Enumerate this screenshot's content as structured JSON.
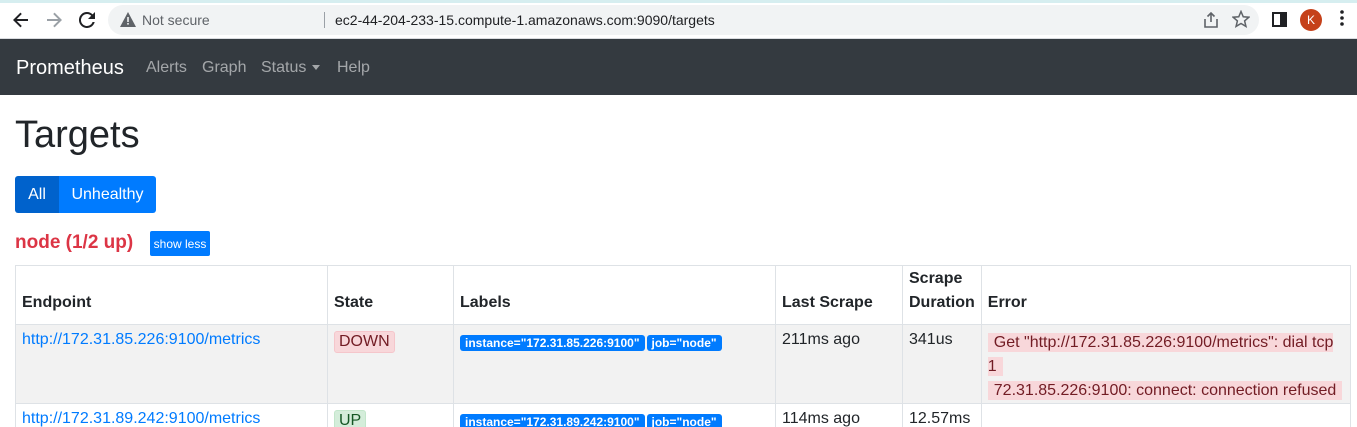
{
  "browser": {
    "security_label": "Not secure",
    "url": "ec2-44-204-233-15.compute-1.amazonaws.com:9090/targets",
    "profile_initial": "K"
  },
  "navbar": {
    "brand": "Prometheus",
    "links": [
      "Alerts",
      "Graph",
      "Status",
      "Help"
    ]
  },
  "page": {
    "title": "Targets",
    "filters": [
      "All",
      "Unhealthy"
    ],
    "job_title": "node (1/2 up)",
    "show_less": "show less"
  },
  "table": {
    "headers": {
      "endpoint": "Endpoint",
      "state": "State",
      "labels": "Labels",
      "last_scrape": "Last Scrape",
      "scrape_duration_1": "Scrape",
      "scrape_duration_2": "Duration",
      "error": "Error"
    },
    "rows": [
      {
        "endpoint": "http://172.31.85.226:9100/metrics",
        "state": "DOWN",
        "label_instance": "instance=\"172.31.85.226:9100\"",
        "label_job": "job=\"node\"",
        "last_scrape": "211ms ago",
        "scrape_duration": "341us",
        "error_line1": "Get \"http://172.31.85.226:9100/metrics\": dial tcp 1",
        "error_line2": "72.31.85.226:9100: connect: connection refused"
      },
      {
        "endpoint": "http://172.31.89.242:9100/metrics",
        "state": "UP",
        "label_instance": "instance=\"172.31.89.242:9100\"",
        "label_job": "job=\"node\"",
        "last_scrape": "114ms ago",
        "scrape_duration": "12.57ms",
        "error_line1": "",
        "error_line2": ""
      }
    ]
  }
}
